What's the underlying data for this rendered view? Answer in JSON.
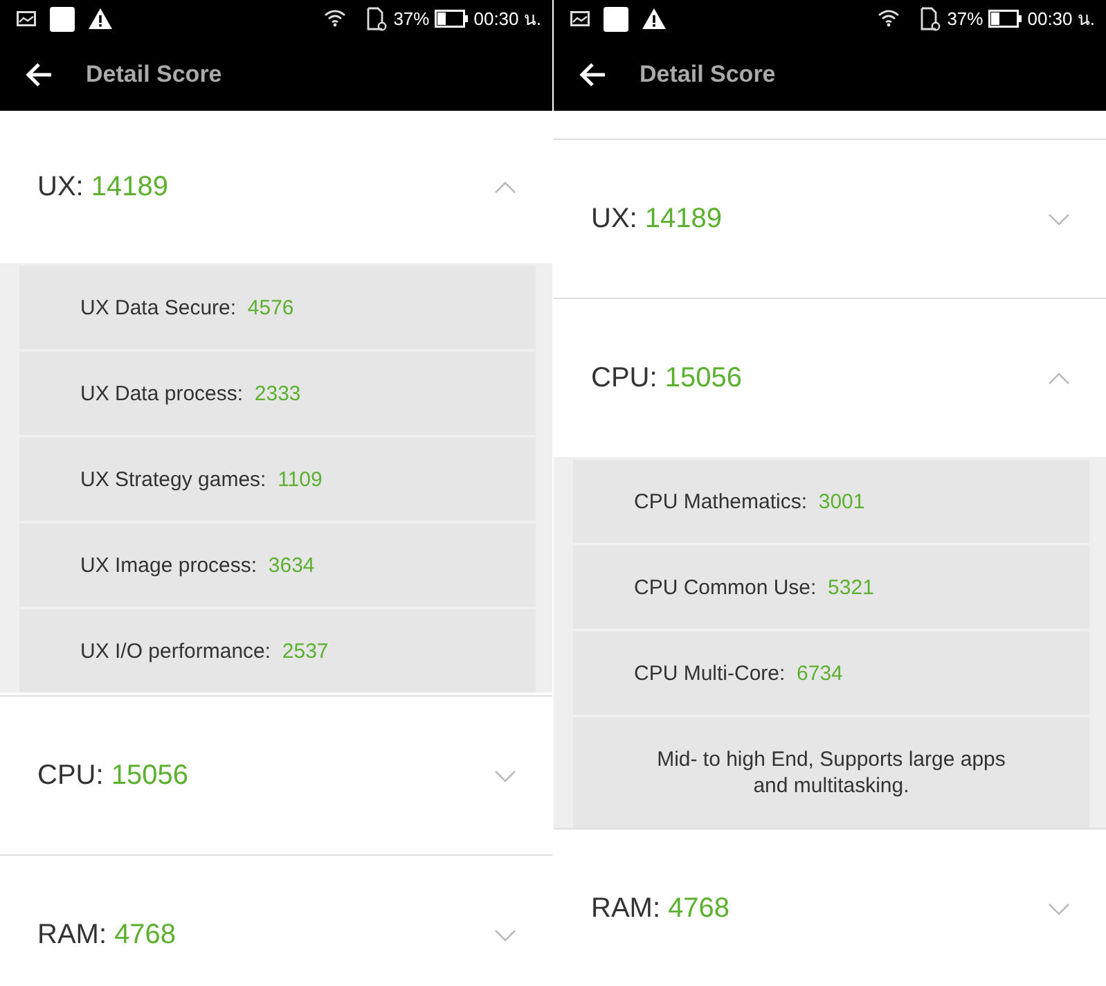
{
  "screens": [
    {
      "status_bar": {
        "battery_text": "37%",
        "time": "00:30 น."
      },
      "title": "Detail Score",
      "scrolled": false,
      "sections": [
        {
          "label": "UX:",
          "score": "14189",
          "expanded": true,
          "items": [
            {
              "label": "UX Data Secure:",
              "score": "4576"
            },
            {
              "label": "UX Data process:",
              "score": "2333"
            },
            {
              "label": "UX Strategy games:",
              "score": "1109"
            },
            {
              "label": "UX Image process:",
              "score": "3634"
            },
            {
              "label": "UX I/O performance:",
              "score": "2537"
            }
          ]
        },
        {
          "label": "CPU:",
          "score": "15056",
          "expanded": false
        },
        {
          "label": "RAM:",
          "score": "4768",
          "expanded": false
        }
      ]
    },
    {
      "status_bar": {
        "battery_text": "37%",
        "time": "00:30 น."
      },
      "title": "Detail Score",
      "scrolled": true,
      "sections": [
        {
          "label": "UX:",
          "score": "14189",
          "expanded": false
        },
        {
          "label": "CPU:",
          "score": "15056",
          "expanded": true,
          "items": [
            {
              "label": "CPU Mathematics:",
              "score": "3001"
            },
            {
              "label": "CPU Common Use:",
              "score": "5321"
            },
            {
              "label": "CPU Multi-Core:",
              "score": "6734"
            }
          ],
          "note": "Mid- to high End, Supports large apps and multitasking."
        },
        {
          "label": "RAM:",
          "score": "4768",
          "expanded": false
        }
      ]
    }
  ]
}
